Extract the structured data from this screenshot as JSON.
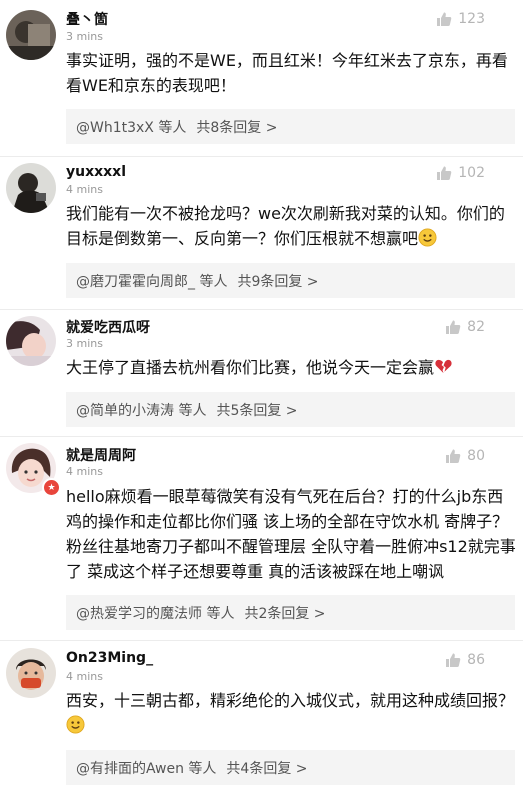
{
  "comments": [
    {
      "username": "叠丶箇",
      "time": "3 mins",
      "likes": "123",
      "lines": [
        "事实证明，强的不是WE，而且红米！今年红米去了京东，再看",
        "看WE和京东的表现吧！"
      ],
      "reply": {
        "user": "@Wh1t3xX",
        "suffix": "等人",
        "count": "共8条回复 >"
      }
    },
    {
      "username": "yuxxxxl",
      "time": "4 mins",
      "likes": "102",
      "lines": [
        "我们能有一次不被抢龙吗？we次次刷新我对菜的认知。你们的",
        "目标是倒数第一、反向第一？你们压根就不想赢吧"
      ],
      "emoji": "smile",
      "reply": {
        "user": "@磨刀霍霍向周郎_",
        "suffix": "等人",
        "count": "共9条回复 >"
      }
    },
    {
      "username": "就爱吃西瓜呀",
      "time": "3 mins",
      "likes": "82",
      "lines": [
        "大王停了直播去杭州看你们比赛，他说今天一定会赢"
      ],
      "emoji": "broken-heart",
      "reply": {
        "user": "@简单的小涛涛",
        "suffix": "等人",
        "count": "共5条回复 >"
      }
    },
    {
      "username": "就是周周阿",
      "time": "4 mins",
      "likes": "80",
      "lines": [
        "hello麻烦看一眼草莓微笑有没有气死在后台？打的什么jb东西",
        "鸡的操作和走位都比你们骚 该上场的全部在守饮水机 寄牌子？",
        "粉丝往基地寄刀子都叫不醒管理层 全队守着一胜俯冲s12就完事",
        "了 菜成这个样子还想要尊重 真的活该被踩在地上嘲讽"
      ],
      "reply": {
        "user": "@热爱学习的魔法师",
        "suffix": "等人",
        "count": "共2条回复 >"
      }
    },
    {
      "username": "On23Ming_",
      "time": "4 mins",
      "likes": "86",
      "lines": [
        "西安，十三朝古都，精彩绝伦的入城仪式，就用这种成绩回报？"
      ],
      "emoji": "smile",
      "reply": {
        "user": "@有排面的Awen",
        "suffix": "等人",
        "count": "共4条回复 >"
      }
    }
  ],
  "colors": {
    "text": "#111111",
    "meta": "#999999",
    "like": "#b5b5b5",
    "replyBg": "#f4f4f4",
    "badge": "#e8453c"
  },
  "icons": {
    "like": "thumbs-up-icon",
    "badge": "star-badge-icon"
  }
}
